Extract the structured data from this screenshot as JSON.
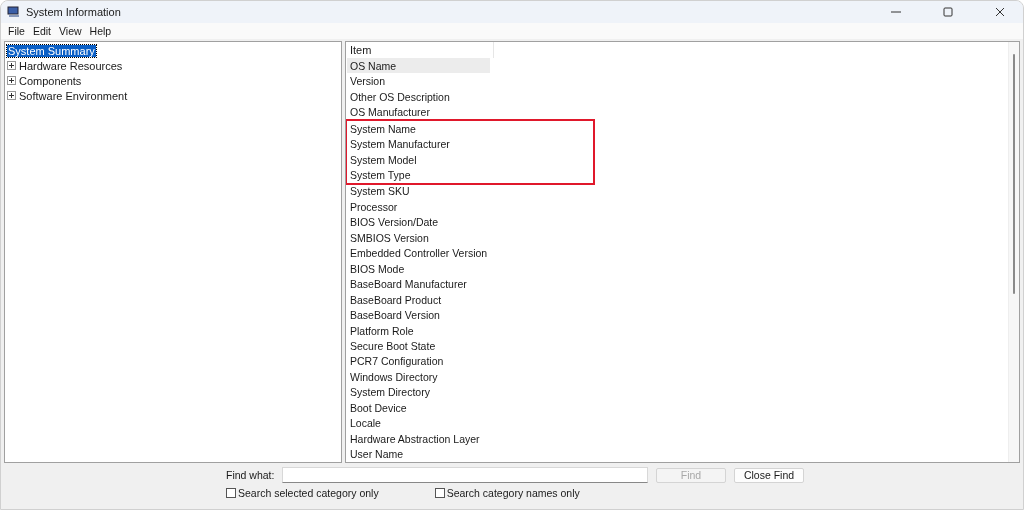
{
  "window": {
    "title": "System Information"
  },
  "menu": [
    "File",
    "Edit",
    "View",
    "Help"
  ],
  "tree": [
    {
      "label": "System Summary",
      "selected": true,
      "expandable": false
    },
    {
      "label": "Hardware Resources",
      "selected": false,
      "expandable": true
    },
    {
      "label": "Components",
      "selected": false,
      "expandable": true
    },
    {
      "label": "Software Environment",
      "selected": false,
      "expandable": true
    }
  ],
  "table": {
    "columns": [
      "Item"
    ],
    "rows": [
      {
        "item": "OS Name",
        "selected": true,
        "highlighted": false
      },
      {
        "item": "Version",
        "selected": false,
        "highlighted": false
      },
      {
        "item": "Other OS Description",
        "selected": false,
        "highlighted": false
      },
      {
        "item": "OS Manufacturer",
        "selected": false,
        "highlighted": false
      },
      {
        "item": "System Name",
        "selected": false,
        "highlighted": true
      },
      {
        "item": "System Manufacturer",
        "selected": false,
        "highlighted": true
      },
      {
        "item": "System Model",
        "selected": false,
        "highlighted": true
      },
      {
        "item": "System Type",
        "selected": false,
        "highlighted": true
      },
      {
        "item": "System SKU",
        "selected": false,
        "highlighted": false
      },
      {
        "item": "Processor",
        "selected": false,
        "highlighted": false
      },
      {
        "item": "BIOS Version/Date",
        "selected": false,
        "highlighted": false
      },
      {
        "item": "SMBIOS Version",
        "selected": false,
        "highlighted": false
      },
      {
        "item": "Embedded Controller Version",
        "selected": false,
        "highlighted": false
      },
      {
        "item": "BIOS Mode",
        "selected": false,
        "highlighted": false
      },
      {
        "item": "BaseBoard Manufacturer",
        "selected": false,
        "highlighted": false
      },
      {
        "item": "BaseBoard Product",
        "selected": false,
        "highlighted": false
      },
      {
        "item": "BaseBoard Version",
        "selected": false,
        "highlighted": false
      },
      {
        "item": "Platform Role",
        "selected": false,
        "highlighted": false
      },
      {
        "item": "Secure Boot State",
        "selected": false,
        "highlighted": false
      },
      {
        "item": "PCR7 Configuration",
        "selected": false,
        "highlighted": false
      },
      {
        "item": "Windows Directory",
        "selected": false,
        "highlighted": false
      },
      {
        "item": "System Directory",
        "selected": false,
        "highlighted": false
      },
      {
        "item": "Boot Device",
        "selected": false,
        "highlighted": false
      },
      {
        "item": "Locale",
        "selected": false,
        "highlighted": false
      },
      {
        "item": "Hardware Abstraction Layer",
        "selected": false,
        "highlighted": false
      },
      {
        "item": "User Name",
        "selected": false,
        "highlighted": false
      }
    ]
  },
  "find": {
    "label": "Find what:",
    "find_button": {
      "label": "Find",
      "disabled": true
    },
    "close_button": {
      "label": "Close Find",
      "disabled": false
    },
    "options": [
      {
        "label": "Search selected category only",
        "checked": false
      },
      {
        "label": "Search category names only",
        "checked": false
      }
    ]
  }
}
